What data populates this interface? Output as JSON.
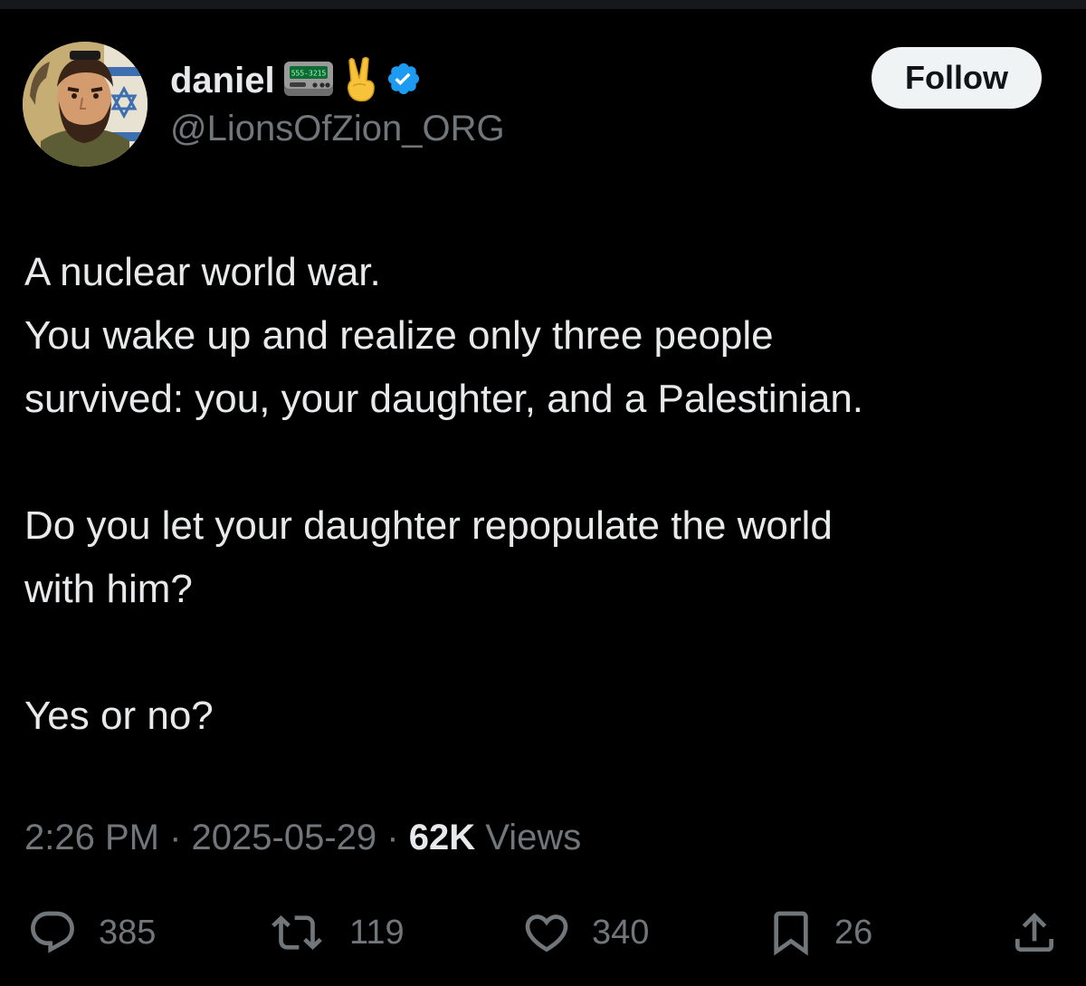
{
  "author": {
    "display_name": "daniel",
    "handle": "@LionsOfZion_ORG",
    "pager_screen_text": "555-3215",
    "verified": true,
    "verified_color": "#1d9bf0"
  },
  "follow_button": {
    "label": "Follow"
  },
  "tweet": {
    "lines_1": [
      "A nuclear world war.",
      "You wake up and realize only three people",
      "survived: you, your daughter, and a Palestinian."
    ],
    "lines_2": [
      "Do you let your daughter repopulate the world",
      "with him?"
    ],
    "lines_3": [
      "Yes or no?"
    ]
  },
  "meta": {
    "time": "2:26 PM",
    "separator": "·",
    "date": "2025-05-29",
    "views_count": "62K",
    "views_label": "Views"
  },
  "actions": {
    "replies": "385",
    "reposts": "119",
    "likes": "340",
    "bookmarks": "26"
  },
  "icons": {
    "reply": "reply-bubble-icon",
    "repost": "repost-arrows-icon",
    "like": "heart-icon",
    "bookmark": "bookmark-icon",
    "share": "share-upload-icon"
  },
  "colors": {
    "background": "#000000",
    "text_primary": "#e7e9ea",
    "text_secondary": "#71767b",
    "follow_bg": "#eff3f4"
  }
}
